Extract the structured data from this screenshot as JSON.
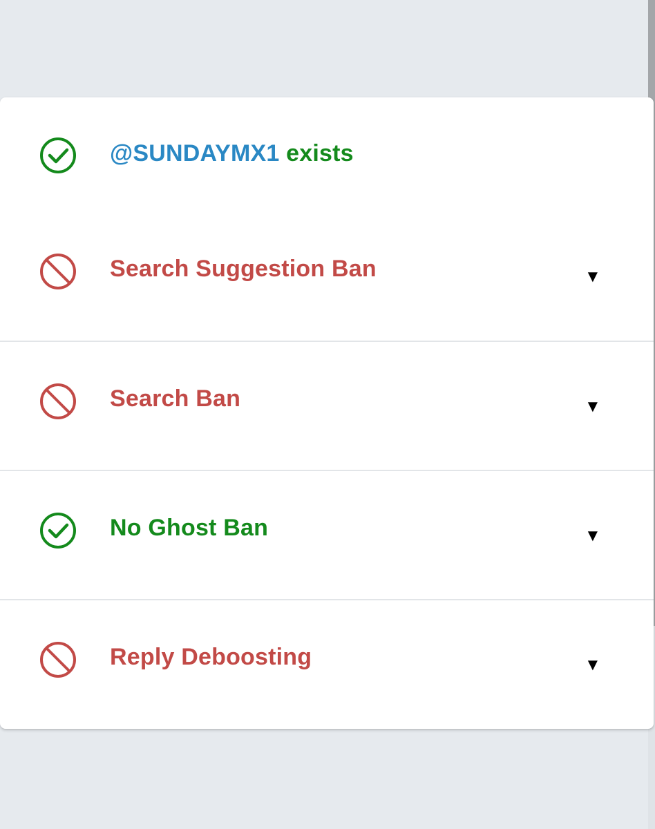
{
  "colors": {
    "background": "#e6eaee",
    "card": "#ffffff",
    "handle_blue": "#2a88c4",
    "pass_green": "#148a1c",
    "fail_red": "#c24a47",
    "divider": "#e2e5e8"
  },
  "header_row": {
    "icon": "check-circle-icon",
    "handle": "@SUNDAYMX1",
    "status_text": "exists"
  },
  "checks": [
    {
      "icon": "ban-circle-icon",
      "label": "Search Suggestion Ban",
      "status": "fail",
      "caret": "▼"
    },
    {
      "icon": "ban-circle-icon",
      "label": "Search Ban",
      "status": "fail",
      "caret": "▼"
    },
    {
      "icon": "check-circle-icon",
      "label": "No Ghost Ban",
      "status": "pass",
      "caret": "▼"
    },
    {
      "icon": "ban-circle-icon",
      "label": "Reply Deboosting",
      "status": "fail",
      "caret": "▼"
    }
  ]
}
